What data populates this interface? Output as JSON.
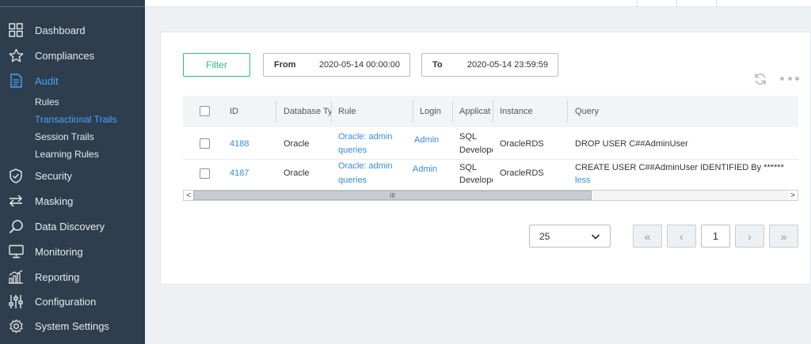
{
  "sidebar": {
    "items": [
      {
        "label": "Dashboard",
        "icon": "grid-icon"
      },
      {
        "label": "Compliances",
        "icon": "star-icon"
      },
      {
        "label": "Audit",
        "icon": "document-icon"
      },
      {
        "label": "Security",
        "icon": "shield-icon"
      },
      {
        "label": "Masking",
        "icon": "swap-icon"
      },
      {
        "label": "Data Discovery",
        "icon": "search-icon"
      },
      {
        "label": "Monitoring",
        "icon": "monitor-icon"
      },
      {
        "label": "Reporting",
        "icon": "bar-chart-icon"
      },
      {
        "label": "Configuration",
        "icon": "sliders-icon"
      },
      {
        "label": "System Settings",
        "icon": "gear-icon"
      }
    ],
    "audit_sub": [
      "Rules",
      "Transactional Trails",
      "Session Trails",
      "Learning Rules"
    ],
    "active_item": "Audit",
    "active_sub": "Transactional Trails",
    "accent": "#4aa3ff",
    "background": "#2e3e4e"
  },
  "toolbar": {
    "filter_label": "Filter",
    "from_label": "From",
    "from_value": "2020-05-14 00:00:00",
    "to_label": "To",
    "to_value": "2020-05-14 23:59:59",
    "filter_color": "#2ebd74"
  },
  "table": {
    "columns": [
      "ID",
      "Database Ty",
      "Rule",
      "Login",
      "Applicat",
      "Instance",
      "Query"
    ],
    "rows": [
      {
        "id": "4188",
        "db": "Oracle",
        "rule1": "Oracle: admin",
        "rule2": "queries",
        "login": "Admin",
        "app1": "SQL",
        "app2": "Develope",
        "instance": "OracleRDS",
        "query": "DROP USER C##AdminUser",
        "query_more": ""
      },
      {
        "id": "4187",
        "db": "Oracle",
        "rule1": "Oracle: admin",
        "rule2": "queries",
        "login": "Admin",
        "app1": "SQL",
        "app2": "Develope",
        "instance": "OracleRDS",
        "query": "CREATE USER C##AdminUser IDENTIFIED By ******",
        "query_more": "less"
      }
    ],
    "link_color": "#3a8ad8"
  },
  "scrollbar": {
    "left": "<",
    "right": ">",
    "grip": "III"
  },
  "pagination": {
    "page_size": "25",
    "first": "«",
    "prev": "‹",
    "current": "1",
    "next": "›",
    "last": "»"
  }
}
